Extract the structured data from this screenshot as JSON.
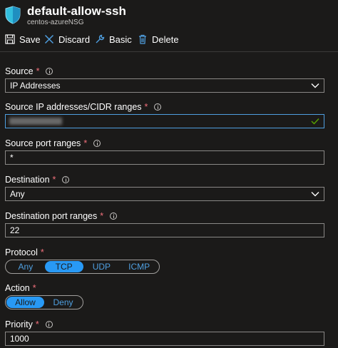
{
  "header": {
    "title": "default-allow-ssh",
    "subtitle": "centos-azureNSG"
  },
  "toolbar": {
    "save": "Save",
    "discard": "Discard",
    "basic": "Basic",
    "delete": "Delete"
  },
  "form": {
    "source": {
      "label": "Source",
      "value": "IP Addresses"
    },
    "source_ip": {
      "label": "Source IP addresses/CIDR ranges",
      "value": ""
    },
    "source_port": {
      "label": "Source port ranges",
      "value": "*"
    },
    "destination": {
      "label": "Destination",
      "value": "Any"
    },
    "dest_port": {
      "label": "Destination port ranges",
      "value": "22"
    },
    "protocol": {
      "label": "Protocol",
      "options": [
        "Any",
        "TCP",
        "UDP",
        "ICMP"
      ],
      "selected": "TCP"
    },
    "action": {
      "label": "Action",
      "options": [
        "Allow",
        "Deny"
      ],
      "selected": "Allow"
    },
    "priority": {
      "label": "Priority",
      "value": "1000"
    }
  },
  "colors": {
    "accent": "#2899f5",
    "required": "#f1707b",
    "valid": "#57a300"
  }
}
